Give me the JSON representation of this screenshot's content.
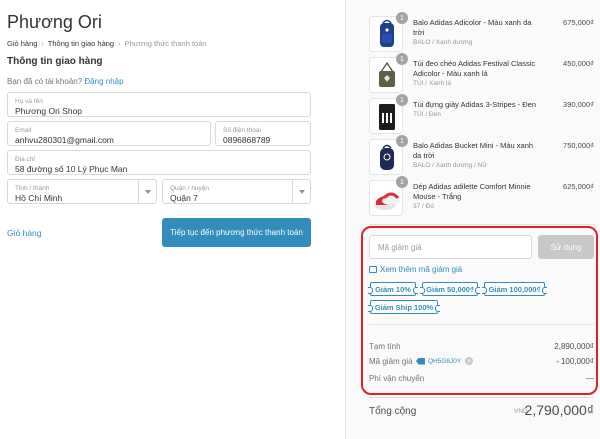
{
  "shop": {
    "name": "Phương Ori"
  },
  "breadcrumbs": [
    "Giỏ hàng",
    "Thông tin giao hàng",
    "Phương thức thanh toán"
  ],
  "section_title": "Thông tin giao hàng",
  "login_prompt": {
    "text": "Bạn đã có tài khoản?",
    "link": "Đăng nhập"
  },
  "form": {
    "name": {
      "label": "Họ và tên",
      "value": "Phương Ori Shop"
    },
    "email": {
      "label": "Email",
      "value": "anhvu280301@gmail.com"
    },
    "phone": {
      "label": "Số điện thoại",
      "value": "0896868789"
    },
    "address": {
      "label": "Địa chỉ",
      "value": "58 đường số 10 Lý Phục Man"
    },
    "province": {
      "label": "Tỉnh / thành",
      "value": "Hồ Chí Minh"
    },
    "district": {
      "label": "Quận / huyện",
      "value": "Quận 7"
    }
  },
  "back_link": "Giỏ hàng",
  "continue_button": "Tiếp tục đến phương thức thanh toán",
  "products": [
    {
      "qty": "1",
      "name": "Balo Adidas Adicolor - Màu xanh da trời",
      "variant": "BALO / Xanh dương",
      "price": "675,000₫"
    },
    {
      "qty": "1",
      "name": "Túi đeo chéo Adidas Festival Classic Adicolor - Màu xanh lá",
      "variant": "TÚI / Xanh lá",
      "price": "450,000₫"
    },
    {
      "qty": "1",
      "name": "Túi đựng giày Adidas 3-Stripes - Đen",
      "variant": "TÚI / Đen",
      "price": "390,000₫"
    },
    {
      "qty": "1",
      "name": "Balo Adidas Bucket Mini - Màu xanh da trời",
      "variant": "BALO / Xanh dương / Nữ",
      "price": "750,000₫"
    },
    {
      "qty": "1",
      "name": "Dép Adidas adilette Comfort Minnie Mouse - Trắng",
      "variant": "37 / Đỏ",
      "price": "625,000₫"
    }
  ],
  "coupon": {
    "placeholder": "Mã giảm giá",
    "apply_label": "Sử dụng",
    "more_link": "Xem thêm mã giảm giá",
    "chips": [
      "Giảm 10%",
      "Giảm 50,000₫",
      "Giảm 100,000₫",
      "Giảm Ship 100%"
    ]
  },
  "summary": {
    "subtotal_label": "Tạm tính",
    "subtotal_value": "2,890,000₫",
    "discount_label": "Mã giảm giá",
    "discount_code": "QH5G8J0Y",
    "discount_value": "- 100,000₫",
    "shipping_label": "Phí vận chuyển",
    "shipping_value": "—",
    "total_label": "Tổng cộng",
    "total_currency": "VND",
    "total_value": "2,790,000₫"
  },
  "colors": {
    "accent": "#338dbc",
    "highlight_border": "#e22027",
    "apply_disabled": "#c8c8c8"
  }
}
